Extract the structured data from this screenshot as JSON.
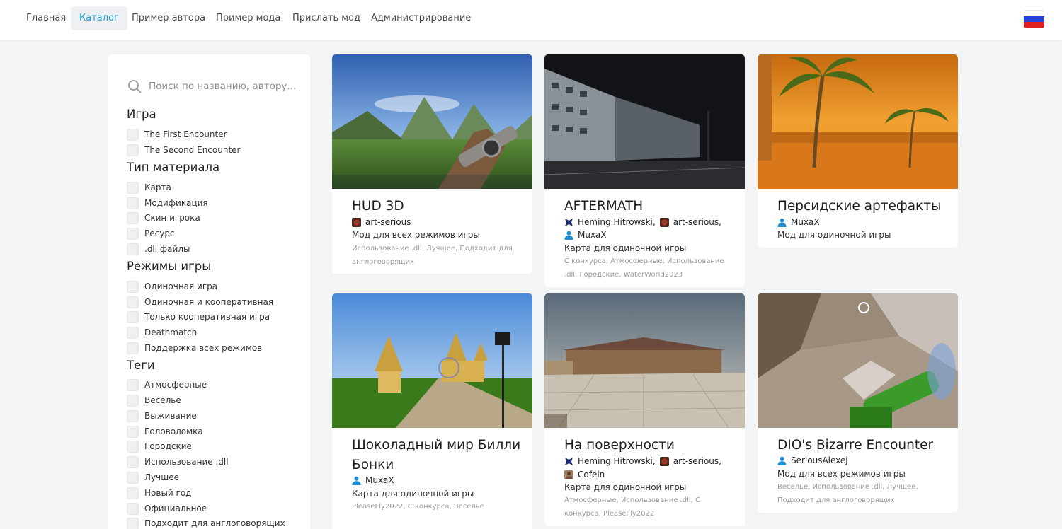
{
  "nav": {
    "items": [
      "Главная",
      "Каталог",
      "Пример автора",
      "Пример мода",
      "Прислать мод",
      "Администрирование"
    ],
    "active": "Каталог"
  },
  "language_flag": {
    "icon": "russian-flag-icon",
    "colors": [
      "#ffffff",
      "#2244d8",
      "#e02020"
    ]
  },
  "search": {
    "placeholder": "Поиск по названию, автору..."
  },
  "filters": {
    "game": {
      "heading": "Игра",
      "options": [
        "The First Encounter",
        "The Second Encounter"
      ]
    },
    "material": {
      "heading": "Тип материала",
      "options": [
        "Карта",
        "Модификация",
        "Скин игрока",
        "Ресурс",
        ".dll файлы"
      ]
    },
    "modes": {
      "heading": "Режимы игры",
      "options": [
        "Одиночная игра",
        "Одиночная и кооперативная",
        "Только кооперативная игра",
        "Deathmatch",
        "Поддержка всех режимов"
      ]
    },
    "tags": {
      "heading": "Теги",
      "options": [
        "Атмосферные",
        "Веселье",
        "Выживание",
        "Головоломка",
        "Городские",
        "Использование .dll",
        "Лучшее",
        "Новый год",
        "Официальное",
        "Подходит для англоговорящих"
      ]
    }
  },
  "cards": [
    {
      "title": "HUD 3D",
      "authors": [
        {
          "name": "art-serious",
          "avatar": "mod-avatar-icon"
        }
      ],
      "type": "Мод для всех режимов игры",
      "tags": "Использование .dll, Лучшее, Подходит для англоговорящих",
      "image": "hud-3d-screenshot"
    },
    {
      "title": "AFTERMATH",
      "authors": [
        {
          "name": "Heming Hitrowski",
          "avatar": "emblem-avatar-icon"
        },
        {
          "name": "art-serious",
          "avatar": "mod-avatar-icon"
        },
        {
          "name": "MuxaX",
          "avatar": "user-icon"
        }
      ],
      "type": "Карта для одиночной игры",
      "tags": "С конкурса, Атмосферные, Использование .dll, Городские, WaterWorld2023",
      "image": "aftermath-screenshot"
    },
    {
      "title": "Персидские артефакты",
      "authors": [
        {
          "name": "MuxaX",
          "avatar": "user-icon"
        }
      ],
      "type": "Мод для одиночной игры",
      "tags": "",
      "image": "persian-artifacts-screenshot"
    },
    {
      "title": "Шоколадный мир Билли Бонки",
      "authors": [
        {
          "name": "MuxaX",
          "avatar": "user-icon"
        }
      ],
      "type": "Карта для одиночной игры",
      "tags": "PleaseFly2022, С конкурса, Веселье",
      "image": "chocolate-world-screenshot"
    },
    {
      "title": "На поверхности",
      "authors": [
        {
          "name": "Heming Hitrowski",
          "avatar": "emblem-avatar-icon"
        },
        {
          "name": "art-serious",
          "avatar": "mod-avatar-icon"
        },
        {
          "name": "Cofein",
          "avatar": "photo-avatar-icon"
        }
      ],
      "type": "Карта для одиночной игры",
      "tags": "Атмосферные, Использование .dll, С конкурса, PleaseFly2022",
      "image": "on-surface-screenshot"
    },
    {
      "title": "DIO's Bizarre Encounter",
      "authors": [
        {
          "name": "SeriousAlexej",
          "avatar": "user-icon"
        }
      ],
      "type": "Мод для всех режимов игры",
      "tags": "Веселье, Использование .dll, Лучшее, Подходит для англоговорящих",
      "image": "dio-bizarre-screenshot"
    }
  ],
  "colors": {
    "accent": "#1aa0c8",
    "user_icon": "#1a8fd6",
    "background": "#f3f4f6"
  }
}
